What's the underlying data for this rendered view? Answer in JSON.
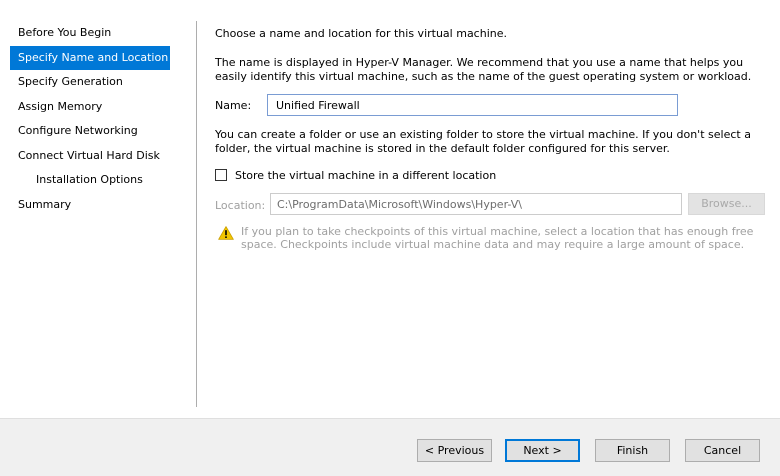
{
  "steps": [
    {
      "label": "Before You Begin"
    },
    {
      "label": "Specify Name and Location"
    },
    {
      "label": "Specify Generation"
    },
    {
      "label": "Assign Memory"
    },
    {
      "label": "Configure Networking"
    },
    {
      "label": "Connect Virtual Hard Disk"
    },
    {
      "label": "Installation Options"
    },
    {
      "label": "Summary"
    }
  ],
  "active_step": "Specify Name and Location",
  "content": {
    "heading": "Choose a name and location for this virtual machine.",
    "description": "The name is displayed in Hyper-V Manager. We recommend that you use a name that helps you easily identify this virtual machine, such as the name of the guest operating system or workload.",
    "name_label": "Name:",
    "name_value": "Unified Firewall",
    "folder_description": "You can create a folder or use an existing folder to store the virtual machine. If you don't select a folder, the virtual machine is stored in the default folder configured for this server.",
    "checkbox_label": "Store the virtual machine in a different location",
    "checkbox_checked": false,
    "location_label": "Location:",
    "location_value": "C:\\ProgramData\\Microsoft\\Windows\\Hyper-V\\",
    "browse_label": "Browse...",
    "warning_text": "If you plan to take checkpoints of this virtual machine, select a location that has enough free space. Checkpoints include virtual machine data and may require a large amount of space."
  },
  "buttons": {
    "previous": "< Previous",
    "next": "Next >",
    "finish": "Finish",
    "cancel": "Cancel"
  },
  "colors": {
    "accent": "#0078d7",
    "warning": "#f2c500",
    "disabled_text": "#a0a0a0"
  },
  "icons": {
    "warning": "warning-icon"
  }
}
